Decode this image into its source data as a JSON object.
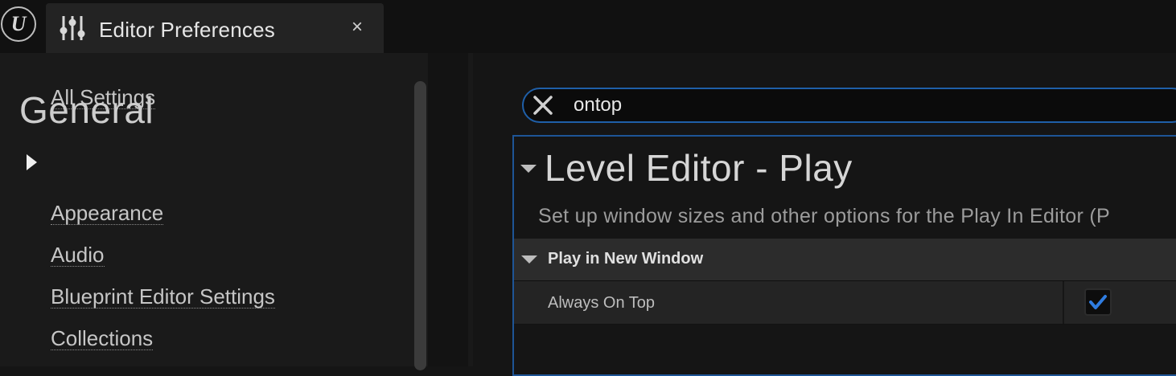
{
  "tab": {
    "title": "Editor Preferences",
    "close_glyph": "×",
    "icon": "sliders-icon",
    "app_logo": "unreal-engine-logo"
  },
  "sidebar": {
    "all_settings": "All Settings",
    "group_title": "General",
    "expanded_arrow_icon": "caret-right-icon",
    "items": [
      {
        "label": "Appearance"
      },
      {
        "label": "Audio"
      },
      {
        "label": "Blueprint Editor Settings"
      },
      {
        "label": "Collections"
      }
    ]
  },
  "search": {
    "value": "ontop",
    "clear_icon": "close-x-icon"
  },
  "section": {
    "title": "Level Editor - Play",
    "description": "Set up window sizes and other options for the Play In Editor (P"
  },
  "category": {
    "label": "Play in New Window"
  },
  "property": {
    "label": "Always On Top",
    "checked": true
  },
  "colors": {
    "accent": "#1f5fa8",
    "check": "#2f7de1",
    "background": "#151515",
    "panel": "#242424"
  }
}
